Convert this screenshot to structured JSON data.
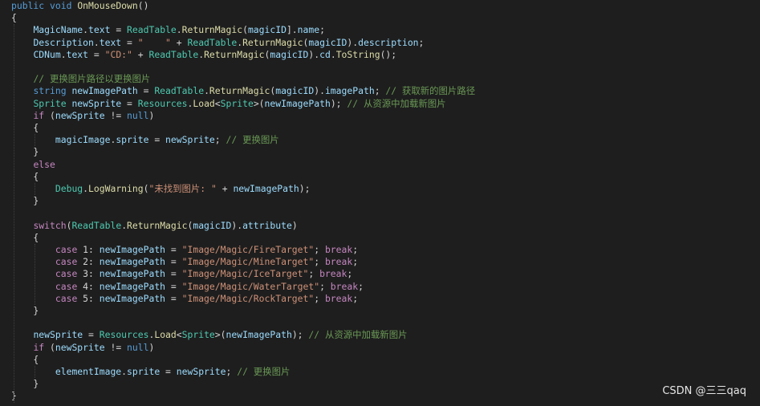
{
  "editor": {
    "language": "C#",
    "theme": {
      "background": "#1e1e1e",
      "keyword": "#569cd6",
      "type": "#4ec9b0",
      "method": "#dcdcaa",
      "variable": "#9cdcfe",
      "string": "#ce9178",
      "comment": "#6a9955",
      "control": "#c586c0",
      "plain": "#d4d4d4"
    },
    "lines": [
      [
        [
          "kw",
          "public "
        ],
        [
          "kw",
          "void "
        ],
        [
          "fn",
          "OnMouseDown"
        ],
        [
          "pl",
          "()"
        ]
      ],
      [
        [
          "pl",
          "{"
        ]
      ],
      [
        [
          "pl",
          "    "
        ],
        [
          "vr",
          "MagicName"
        ],
        [
          "pl",
          "."
        ],
        [
          "vr",
          "text"
        ],
        [
          "pl",
          " = "
        ],
        [
          "ty",
          "ReadTable"
        ],
        [
          "pl",
          "."
        ],
        [
          "fn",
          "ReturnMagic"
        ],
        [
          "pl",
          "("
        ],
        [
          "vr",
          "magicID"
        ],
        [
          "pl",
          "]."
        ],
        [
          "vr",
          "name"
        ],
        [
          "pl",
          ";"
        ]
      ],
      [
        [
          "pl",
          "    "
        ],
        [
          "vr",
          "Description"
        ],
        [
          "pl",
          "."
        ],
        [
          "vr",
          "text"
        ],
        [
          "pl",
          " = "
        ],
        [
          "st",
          "\"    \""
        ],
        [
          "pl",
          " + "
        ],
        [
          "ty",
          "ReadTable"
        ],
        [
          "pl",
          "."
        ],
        [
          "fn",
          "ReturnMagic"
        ],
        [
          "pl",
          "("
        ],
        [
          "vr",
          "magicID"
        ],
        [
          "pl",
          ")."
        ],
        [
          "vr",
          "description"
        ],
        [
          "pl",
          ";"
        ]
      ],
      [
        [
          "pl",
          "    "
        ],
        [
          "vr",
          "CDNum"
        ],
        [
          "pl",
          "."
        ],
        [
          "vr",
          "text"
        ],
        [
          "pl",
          " = "
        ],
        [
          "st",
          "\"CD:\""
        ],
        [
          "pl",
          " + "
        ],
        [
          "ty",
          "ReadTable"
        ],
        [
          "pl",
          "."
        ],
        [
          "fn",
          "ReturnMagic"
        ],
        [
          "pl",
          "("
        ],
        [
          "vr",
          "magicID"
        ],
        [
          "pl",
          ")."
        ],
        [
          "vr",
          "cd"
        ],
        [
          "pl",
          "."
        ],
        [
          "fn",
          "ToString"
        ],
        [
          "pl",
          "();"
        ]
      ],
      [],
      [
        [
          "pl",
          "    "
        ],
        [
          "cm",
          "// 更换图片路径以更换图片"
        ]
      ],
      [
        [
          "pl",
          "    "
        ],
        [
          "kw",
          "string "
        ],
        [
          "vr",
          "newImagePath"
        ],
        [
          "pl",
          " = "
        ],
        [
          "ty",
          "ReadTable"
        ],
        [
          "pl",
          "."
        ],
        [
          "fn",
          "ReturnMagic"
        ],
        [
          "pl",
          "("
        ],
        [
          "vr",
          "magicID"
        ],
        [
          "pl",
          ")."
        ],
        [
          "vr",
          "imagePath"
        ],
        [
          "pl",
          "; "
        ],
        [
          "cm",
          "// 获取新的图片路径"
        ]
      ],
      [
        [
          "pl",
          "    "
        ],
        [
          "ty",
          "Sprite "
        ],
        [
          "vr",
          "newSprite"
        ],
        [
          "pl",
          " = "
        ],
        [
          "ty",
          "Resources"
        ],
        [
          "pl",
          "."
        ],
        [
          "fn",
          "Load"
        ],
        [
          "pl",
          "<"
        ],
        [
          "ty",
          "Sprite"
        ],
        [
          "pl",
          ">("
        ],
        [
          "vr",
          "newImagePath"
        ],
        [
          "pl",
          "); "
        ],
        [
          "cm",
          "// 从资源中加载新图片"
        ]
      ],
      [
        [
          "pl",
          "    "
        ],
        [
          "ct",
          "if "
        ],
        [
          "pl",
          "("
        ],
        [
          "vr",
          "newSprite"
        ],
        [
          "pl",
          " != "
        ],
        [
          "kw",
          "null"
        ],
        [
          "pl",
          ")"
        ]
      ],
      [
        [
          "pl",
          "    {"
        ]
      ],
      [
        [
          "pl",
          "        "
        ],
        [
          "vr",
          "magicImage"
        ],
        [
          "pl",
          "."
        ],
        [
          "vr",
          "sprite"
        ],
        [
          "pl",
          " = "
        ],
        [
          "vr",
          "newSprite"
        ],
        [
          "pl",
          "; "
        ],
        [
          "cm",
          "// 更换图片"
        ]
      ],
      [
        [
          "pl",
          "    }"
        ]
      ],
      [
        [
          "pl",
          "    "
        ],
        [
          "ct",
          "else"
        ]
      ],
      [
        [
          "pl",
          "    {"
        ]
      ],
      [
        [
          "pl",
          "        "
        ],
        [
          "ty",
          "Debug"
        ],
        [
          "pl",
          "."
        ],
        [
          "fn",
          "LogWarning"
        ],
        [
          "pl",
          "("
        ],
        [
          "st",
          "\"未找到图片: \""
        ],
        [
          "pl",
          " + "
        ],
        [
          "vr",
          "newImagePath"
        ],
        [
          "pl",
          ");"
        ]
      ],
      [
        [
          "pl",
          "    }"
        ]
      ],
      [],
      [
        [
          "pl",
          "    "
        ],
        [
          "ct",
          "switch"
        ],
        [
          "pl",
          "("
        ],
        [
          "ty",
          "ReadTable"
        ],
        [
          "pl",
          "."
        ],
        [
          "fn",
          "ReturnMagic"
        ],
        [
          "pl",
          "("
        ],
        [
          "vr",
          "magicID"
        ],
        [
          "pl",
          ")."
        ],
        [
          "vr",
          "attribute"
        ],
        [
          "pl",
          ")"
        ]
      ],
      [
        [
          "pl",
          "    {"
        ]
      ],
      [
        [
          "pl",
          "        "
        ],
        [
          "ct",
          "case "
        ],
        [
          "pl",
          "1: "
        ],
        [
          "vr",
          "newImagePath"
        ],
        [
          "pl",
          " = "
        ],
        [
          "st",
          "\"Image/Magic/FireTarget\""
        ],
        [
          "pl",
          "; "
        ],
        [
          "ct",
          "break"
        ],
        [
          "pl",
          ";"
        ]
      ],
      [
        [
          "pl",
          "        "
        ],
        [
          "ct",
          "case "
        ],
        [
          "pl",
          "2: "
        ],
        [
          "vr",
          "newImagePath"
        ],
        [
          "pl",
          " = "
        ],
        [
          "st",
          "\"Image/Magic/MineTarget\""
        ],
        [
          "pl",
          "; "
        ],
        [
          "ct",
          "break"
        ],
        [
          "pl",
          ";"
        ]
      ],
      [
        [
          "pl",
          "        "
        ],
        [
          "ct",
          "case "
        ],
        [
          "pl",
          "3: "
        ],
        [
          "vr",
          "newImagePath"
        ],
        [
          "pl",
          " = "
        ],
        [
          "st",
          "\"Image/Magic/IceTarget\""
        ],
        [
          "pl",
          "; "
        ],
        [
          "ct",
          "break"
        ],
        [
          "pl",
          ";"
        ]
      ],
      [
        [
          "pl",
          "        "
        ],
        [
          "ct",
          "case "
        ],
        [
          "pl",
          "4: "
        ],
        [
          "vr",
          "newImagePath"
        ],
        [
          "pl",
          " = "
        ],
        [
          "st",
          "\"Image/Magic/WaterTarget\""
        ],
        [
          "pl",
          "; "
        ],
        [
          "ct",
          "break"
        ],
        [
          "pl",
          ";"
        ]
      ],
      [
        [
          "pl",
          "        "
        ],
        [
          "ct",
          "case "
        ],
        [
          "pl",
          "5: "
        ],
        [
          "vr",
          "newImagePath"
        ],
        [
          "pl",
          " = "
        ],
        [
          "st",
          "\"Image/Magic/RockTarget\""
        ],
        [
          "pl",
          "; "
        ],
        [
          "ct",
          "break"
        ],
        [
          "pl",
          ";"
        ]
      ],
      [
        [
          "pl",
          "    }"
        ]
      ],
      [],
      [
        [
          "pl",
          "    "
        ],
        [
          "vr",
          "newSprite"
        ],
        [
          "pl",
          " = "
        ],
        [
          "ty",
          "Resources"
        ],
        [
          "pl",
          "."
        ],
        [
          "fn",
          "Load"
        ],
        [
          "pl",
          "<"
        ],
        [
          "ty",
          "Sprite"
        ],
        [
          "pl",
          ">("
        ],
        [
          "vr",
          "newImagePath"
        ],
        [
          "pl",
          "); "
        ],
        [
          "cm",
          "// 从资源中加载新图片"
        ]
      ],
      [
        [
          "pl",
          "    "
        ],
        [
          "ct",
          "if "
        ],
        [
          "pl",
          "("
        ],
        [
          "vr",
          "newSprite"
        ],
        [
          "pl",
          " != "
        ],
        [
          "kw",
          "null"
        ],
        [
          "pl",
          ")"
        ]
      ],
      [
        [
          "pl",
          "    {"
        ]
      ],
      [
        [
          "pl",
          "        "
        ],
        [
          "vr",
          "elementImage"
        ],
        [
          "pl",
          "."
        ],
        [
          "vr",
          "sprite"
        ],
        [
          "pl",
          " = "
        ],
        [
          "vr",
          "newSprite"
        ],
        [
          "pl",
          "; "
        ],
        [
          "cm",
          "// 更换图片"
        ]
      ],
      [
        [
          "pl",
          "    }"
        ]
      ],
      [
        [
          "pl",
          "}"
        ]
      ]
    ]
  },
  "watermark": "CSDN @三三qaq"
}
